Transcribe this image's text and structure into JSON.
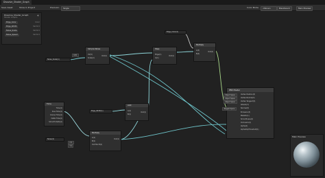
{
  "window": {
    "tab_title": "Dissolve_Shader_Graph"
  },
  "toolbar": {
    "save_asset": "Save Asset",
    "show_in_project": "Show In Project",
    "precision_label": "Precision",
    "precision_value": "Single",
    "color_mode_label": "Color Mode",
    "color_mode_value": "<None>",
    "blackboard_btn": "Blackboard",
    "main_preview_btn": "Main Preview"
  },
  "blackboard": {
    "title": "Dissolve_Shader_Graph",
    "subtitle": "Shader Graphs",
    "add": "+",
    "properties": [
      {
        "name": "Edge_Color",
        "type": "Color"
      },
      {
        "name": "Edge_Width",
        "type": "Vector1"
      },
      {
        "name": "Noise_Scale",
        "type": "Vector1"
      },
      {
        "name": "Noise_Speed",
        "type": "Vector1"
      }
    ]
  },
  "nodes": {
    "simple_noise": {
      "title": "Simple Noise",
      "inputs": [
        "UV(2)",
        "Scale(1)"
      ],
      "output": "Out(1)"
    },
    "step": {
      "title": "Step",
      "inputs": [
        "Edge(1)",
        "In(1)"
      ],
      "output": "Out(1)"
    },
    "multiply_top": {
      "title": "Multiply",
      "inputs": [
        "A(4)",
        "B(4)"
      ],
      "output": "Out(4)"
    },
    "add": {
      "title": "Add",
      "inputs": [
        "A(1)",
        "B(1)"
      ],
      "output": "Out(1)"
    },
    "time": {
      "title": "Time",
      "outputs": [
        "Time(1)",
        "Sine Time(1)",
        "Cosine Time(1)",
        "Delta Time(1)",
        "Smooth Delta(1)"
      ]
    },
    "multiply_bottom": {
      "title": "Multiply",
      "inputs": [
        "A(1)",
        "B(1)",
        "Out Mul B(1)"
      ],
      "output": "Out(1)"
    },
    "pbr_master": {
      "title": "PBR Master",
      "inputs": [
        "Vertex Position(3)",
        "Vertex Normal(3)",
        "Vertex Tangent(3)",
        "Albedo(3)",
        "Normal(3)",
        "Emission(3)",
        "Metallic(1)",
        "Smoothness(1)",
        "Occlusion(1)",
        "Alpha(1)",
        "AlphaClipThreshold(1)"
      ],
      "chips": [
        "Object Space",
        "Object Space",
        "Object Space",
        "",
        "Tangent Space"
      ]
    }
  },
  "props_on_graph": {
    "edge_color": "Edge_Color(4)",
    "noise_scale": "Noise_Scale(1)",
    "edge_width": "Edge_Width(1)",
    "noise_speed": "Noise(1)"
  },
  "inline_inputs": {
    "uv": "UV0",
    "x": "X 0",
    "y": "Y 0"
  },
  "main_preview": {
    "title": "Main Preview"
  }
}
